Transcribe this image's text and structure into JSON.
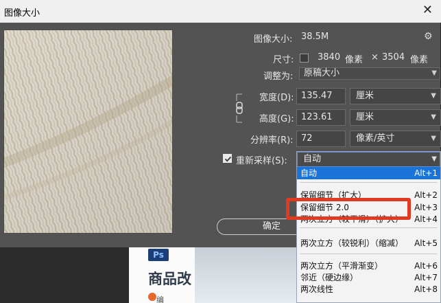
{
  "window": {
    "title": "图像大小",
    "close_glyph": "✕"
  },
  "image_size": {
    "label": "图像大小:",
    "value": "38.5M"
  },
  "dimensions": {
    "label": "尺寸:",
    "width_px": "3840",
    "width_unit": "像素",
    "times": "×",
    "height_px": "3504",
    "height_unit": "像素"
  },
  "fit_to": {
    "label": "调整为:",
    "value": "原稿大小"
  },
  "width": {
    "label": "宽度(D):",
    "value": "135.47",
    "unit": "厘米"
  },
  "height": {
    "label": "高度(G):",
    "value": "123.61",
    "unit": "厘米"
  },
  "resolution": {
    "label": "分辨率(R):",
    "value": "72",
    "unit": "像素/英寸"
  },
  "resample": {
    "label": "重新采样(S):",
    "checked": true,
    "value": "自动"
  },
  "ok_button": "确定",
  "menu": {
    "items": [
      {
        "label": "自动",
        "shortcut": "Alt+1",
        "selected": true
      },
      {
        "label": "保留细节（扩大）",
        "shortcut": "Alt+2"
      },
      {
        "label": "保留细节 2.0",
        "shortcut": "Alt+3"
      },
      {
        "label": "两次立方（较平滑）（扩大）",
        "shortcut": "Alt+4"
      },
      {
        "label": "两次立方（较锐利）（缩减）",
        "shortcut": "Alt+5"
      },
      {
        "label": "两次立方（平滑渐变）",
        "shortcut": "Alt+6"
      },
      {
        "label": "邻近（硬边缘）",
        "shortcut": "Alt+7"
      },
      {
        "label": "两次线性",
        "shortcut": "Alt+8"
      }
    ]
  },
  "background": {
    "ps_badge": "Ps",
    "headline": "商品改",
    "subtext": "编"
  },
  "colors": {
    "highlight": "#1a73d9",
    "annotation": "#e03a22",
    "dialog_bg": "#535353"
  },
  "icons": [
    "gear-icon",
    "chain-link-icon",
    "checkbox-checked-icon",
    "chevron-down-icon",
    "close-icon"
  ]
}
